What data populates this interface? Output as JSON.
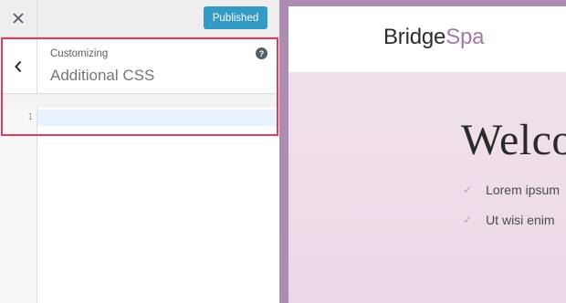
{
  "customizer": {
    "close_label": "×",
    "publish_label": "Published",
    "section": {
      "customizing_label": "Customizing",
      "title": "Additional CSS",
      "help_label": "?"
    },
    "editor": {
      "line_numbers": [
        "1"
      ],
      "code": ""
    }
  },
  "preview": {
    "logo": {
      "main": "Bridge",
      "accent": "Spa"
    },
    "hero": {
      "title": "Welco",
      "items": [
        "Lorem ipsum",
        "Ut wisi enim"
      ]
    }
  },
  "colors": {
    "publish_button": "#0085ba",
    "highlight_border": "#e23a5b",
    "logo_accent": "#a27aa7",
    "preview_frame": "#ad8cb1"
  }
}
